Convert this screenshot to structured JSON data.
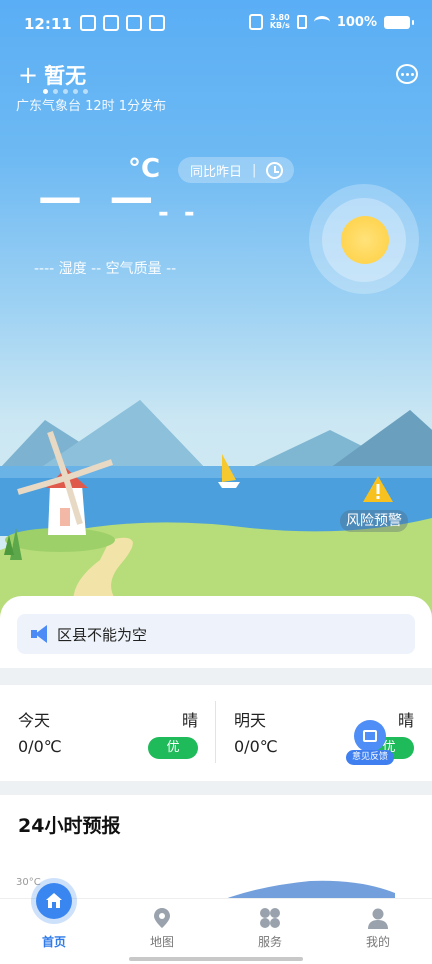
{
  "status_bar": {
    "time": "12:11",
    "net_speed_value": "3.80",
    "net_speed_unit": "KB/s",
    "battery": "100%"
  },
  "header": {
    "city": "暂无",
    "publish_info": "广东气象台 12时 1分发布",
    "page_dots": 5,
    "active_dot": 0
  },
  "current": {
    "temp_unit": "°C",
    "compare_label": "同比昨日",
    "compare_sep": "|",
    "temp_big": "— —",
    "temp_small": "- -",
    "info_line": "----  湿度 --  空气质量 --"
  },
  "risk": {
    "label": "风险预警",
    "icon": "warning-triangle-icon"
  },
  "notice": {
    "text": "区县不能为空",
    "icon": "speaker-icon"
  },
  "days": [
    {
      "name": "今天",
      "condition": "晴",
      "temp": "0/0℃",
      "aqi": "优"
    },
    {
      "name": "明天",
      "condition": "晴",
      "temp": "0/0℃",
      "aqi": "优"
    }
  ],
  "feedback": {
    "label": "意见反馈"
  },
  "forecast": {
    "title": "24小时预报",
    "tick": "30°C"
  },
  "nav": [
    {
      "label": "首页",
      "icon": "home-icon",
      "active": true
    },
    {
      "label": "地图",
      "icon": "map-pin-icon",
      "active": false
    },
    {
      "label": "服务",
      "icon": "grid-icon",
      "active": false
    },
    {
      "label": "我的",
      "icon": "user-icon",
      "active": false
    }
  ],
  "colors": {
    "sky_top": "#5aaef5",
    "accent_blue": "#3a86f0",
    "aqi_green": "#1fba5a",
    "sun": "#ffcf3f"
  }
}
